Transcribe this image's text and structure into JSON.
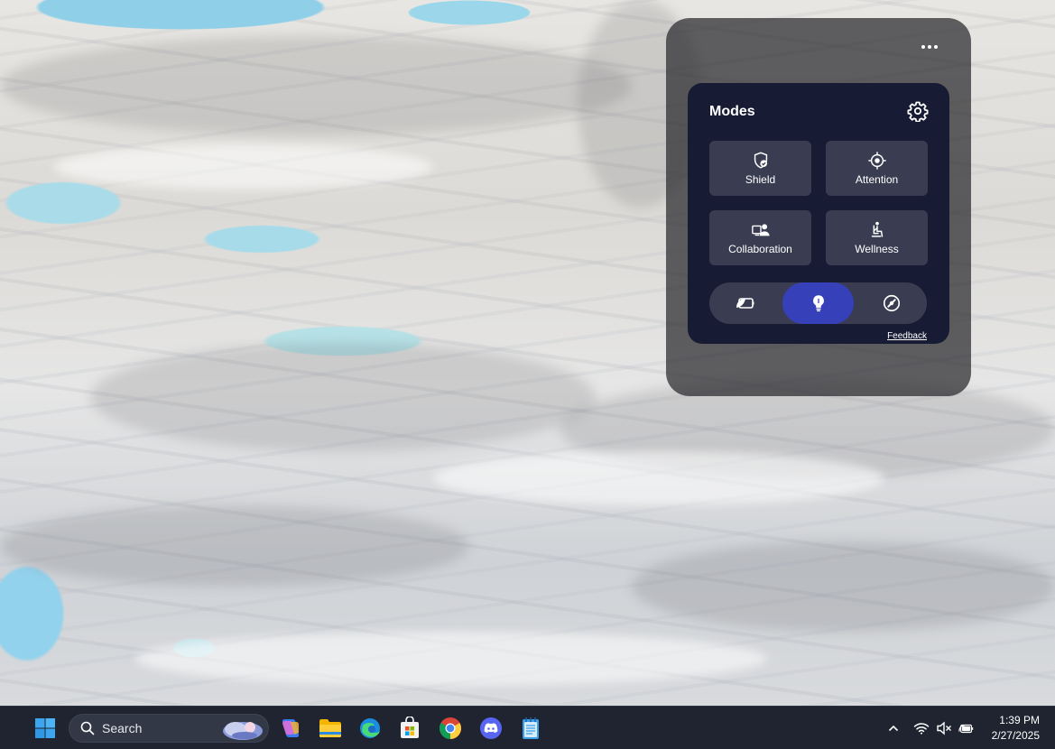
{
  "widget": {
    "title": "Modes",
    "more_icon": "more-horizontal-icon",
    "settings_icon": "gear-icon",
    "tiles": [
      {
        "label": "Shield",
        "icon": "shield-check-icon"
      },
      {
        "label": "Attention",
        "icon": "crosshair-icon"
      },
      {
        "label": "Collaboration",
        "icon": "collaboration-icon"
      },
      {
        "label": "Wellness",
        "icon": "seated-person-icon"
      }
    ],
    "toggle_options": [
      {
        "icon": "battery-saver-icon",
        "active": false
      },
      {
        "icon": "lightbulb-icon",
        "active": true
      },
      {
        "icon": "speedometer-icon",
        "active": false
      }
    ],
    "feedback_label": "Feedback",
    "accent_color": "#3640b8",
    "card_color": "#181b34",
    "tile_color": "#3a3d52"
  },
  "taskbar": {
    "start_icon": "windows-start-icon",
    "search_placeholder": "Search",
    "pinned_apps": [
      {
        "name": "copilot-icon"
      },
      {
        "name": "file-explorer-icon"
      },
      {
        "name": "edge-icon"
      },
      {
        "name": "microsoft-store-icon"
      },
      {
        "name": "chrome-icon"
      },
      {
        "name": "discord-icon"
      },
      {
        "name": "notepad-icon"
      }
    ],
    "tray": {
      "overflow_icon": "chevron-up-icon",
      "wifi_icon": "wifi-icon",
      "volume_icon": "volume-muted-icon",
      "battery_icon": "battery-icon"
    },
    "time": "1:39 PM",
    "date": "2/27/2025"
  }
}
